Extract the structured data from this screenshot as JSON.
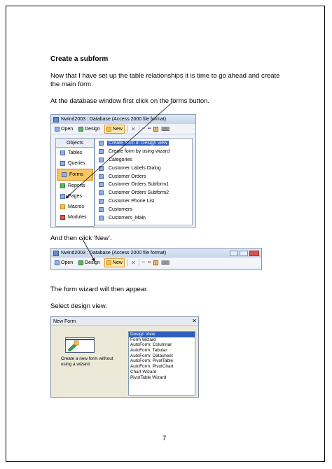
{
  "heading": "Create a subform",
  "para1_line1": "Now that I have set up the table relationships it is time to go ahead and create",
  "para1_line2": "the main form.",
  "para2": "At the database window first click on the forms button.",
  "para3": "And then click ‘New’.",
  "para4": "The form wizard will then appear.",
  "para5": "Select design view.",
  "page_number": "7",
  "shot1": {
    "title": "Nwind2003 : Database (Access 2000 file format)",
    "toolbar": {
      "open": "Open",
      "design": "Design",
      "new": "New"
    },
    "objects_header": "Objects",
    "objects": [
      "Tables",
      "Queries",
      "Forms",
      "Reports",
      "Pages",
      "Macros",
      "Modules"
    ],
    "list": [
      "Create form in Design view",
      "Create form by using wizard",
      "Categories",
      "Customer Labels Dialog",
      "Customer Orders",
      "Customer Orders Subform1",
      "Customer Orders Subform2",
      "Customer Phone List",
      "Customers",
      "Customers_Main"
    ]
  },
  "shot2": {
    "title": "Nwind2003 : Database (Access 2000 file format)",
    "toolbar": {
      "open": "Open",
      "design": "Design",
      "new": "New"
    }
  },
  "dialog": {
    "title": "New Form",
    "description": "Create a new form without using a wizard.",
    "options": [
      "Design View",
      "Form Wizard",
      "AutoForm: Columnar",
      "AutoForm: Tabular",
      "AutoForm: Datasheet",
      "AutoForm: PivotTable",
      "AutoForm: PivotChart",
      "Chart Wizard",
      "PivotTable Wizard"
    ]
  }
}
